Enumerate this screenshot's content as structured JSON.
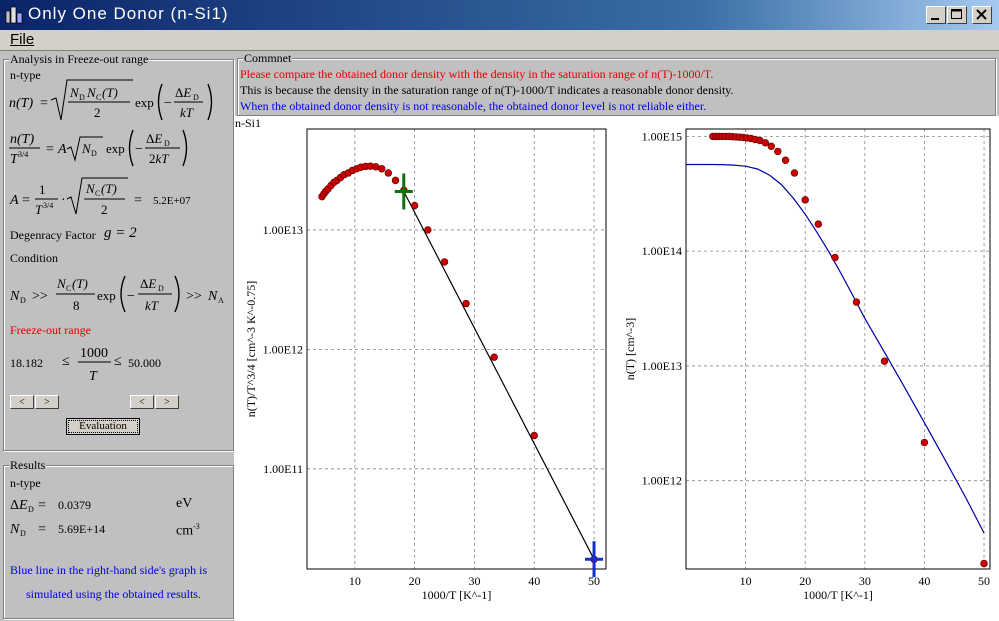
{
  "window": {
    "title": "Only One Donor (n-Si1)"
  },
  "menu": {
    "file": "File"
  },
  "analysis": {
    "group_title": "Analysis in Freeze-out range",
    "type_label": "n-type",
    "a_value": "5.2E+07",
    "degeneracy_label": "Degenracy Factor",
    "degeneracy_value": "g = 2",
    "condition_label": "Condition",
    "freezeout_label": "Freeze-out range",
    "range_min": "18.182",
    "range_max": "50.000",
    "le1": "≤",
    "le2": "≤",
    "btn_left": "<",
    "btn_right": ">",
    "evaluation_label": "Evaluation"
  },
  "results": {
    "group_title": "Results",
    "type_label": "n-type",
    "delta_e_value": "0.0379",
    "delta_e_unit": "eV",
    "nd_value": "5.69E+14",
    "nd_unit": "cm",
    "nd_unit_exp": "-3",
    "note_line1": "Blue line in the right-hand side's graph is",
    "note_line2": "simulated using the obtained results."
  },
  "comment": {
    "group_title": "Commnet",
    "line1": "Please compare the obtained donor density with the density in the saturation range of n(T)-1000/T.",
    "line2": "This is because the density in the saturation range of n(T)-1000/T indicates a reasonable donor density.",
    "line3": "When the obtained donor density is not reasonable, the obtained donor level is not reliable either."
  },
  "sample_label": "n-Si1",
  "colors": {
    "red_text": "#e00000",
    "blue_text": "#0000e0",
    "marker": "#cc0000",
    "fit_line": "#000000",
    "sim_line": "#0000aa",
    "cursor_green": "#107010",
    "cursor_blue": "#1030d0"
  },
  "chart_data": [
    {
      "type": "scatter",
      "scale_y": "log",
      "xlabel": "1000/T  [K^-1]",
      "ylabel": "n(T)/T^3/4  [cm^-3 K^-0.75]",
      "xlim": [
        2,
        52
      ],
      "ylim": [
        14500000000.0,
        70000000000000.0
      ],
      "x_ticks": [
        10,
        20,
        30,
        40,
        50
      ],
      "y_ticks": [
        {
          "v": 10000000000000.0,
          "label": "1.00E13"
        },
        {
          "v": 1000000000000.0,
          "label": "1.00E12"
        },
        {
          "v": 100000000000.0,
          "label": "1.00E11"
        }
      ],
      "grid": true,
      "points": [
        [
          4.5,
          19000000000000.0
        ],
        [
          4.8,
          20000000000000.0
        ],
        [
          5.1,
          21000000000000.0
        ],
        [
          5.5,
          22000000000000.0
        ],
        [
          6.0,
          23500000000000.0
        ],
        [
          6.5,
          25000000000000.0
        ],
        [
          7.0,
          26000000000000.0
        ],
        [
          7.6,
          27500000000000.0
        ],
        [
          8.2,
          29000000000000.0
        ],
        [
          8.9,
          30000000000000.0
        ],
        [
          9.6,
          31500000000000.0
        ],
        [
          10.3,
          32500000000000.0
        ],
        [
          11.0,
          33500000000000.0
        ],
        [
          11.8,
          34000000000000.0
        ],
        [
          12.6,
          34200000000000.0
        ],
        [
          13.5,
          33800000000000.0
        ],
        [
          14.5,
          32500000000000.0
        ],
        [
          15.6,
          30000000000000.0
        ],
        [
          16.8,
          26000000000000.0
        ],
        [
          18.2,
          21500000000000.0
        ],
        [
          20.0,
          16000000000000.0
        ],
        [
          22.2,
          10000000000000.0
        ],
        [
          25.0,
          5400000000000.0
        ],
        [
          28.6,
          2420000000000.0
        ],
        [
          33.3,
          860000000000.0
        ],
        [
          40.0,
          190000000000.0
        ],
        [
          50.0,
          17500000000.0
        ]
      ],
      "fit_line": [
        [
          18.182,
          21000000000000.0
        ],
        [
          50.0,
          17500000000.0
        ]
      ],
      "cursors": [
        {
          "x": 18.182,
          "y": 21000000000000.0,
          "color": "green"
        },
        {
          "x": 50.0,
          "y": 17500000000.0,
          "color": "blue"
        }
      ]
    },
    {
      "type": "scatter",
      "scale_y": "log",
      "xlabel": "1000/T  [K^-1]",
      "ylabel": "n(T)  [cm^-3]",
      "xlim": [
        0,
        51
      ],
      "ylim": [
        170000000000.0,
        1160000000000000.0
      ],
      "x_ticks": [
        10,
        20,
        30,
        40,
        50
      ],
      "y_ticks": [
        {
          "v": 1000000000000000.0,
          "label": "1.00E15"
        },
        {
          "v": 100000000000000.0,
          "label": "1.00E14"
        },
        {
          "v": 10000000000000.0,
          "label": "1.00E13"
        },
        {
          "v": 1000000000000.0,
          "label": "1.00E12"
        }
      ],
      "grid": true,
      "points": [
        [
          4.5,
          1000000000000000.0
        ],
        [
          5.0,
          1000000000000000.0
        ],
        [
          5.5,
          1000000000000000.0
        ],
        [
          6.0,
          1000000000000000.0
        ],
        [
          6.6,
          1000000000000000.0
        ],
        [
          7.2,
          1000000000000000.0
        ],
        [
          7.8,
          995000000000000.0
        ],
        [
          8.4,
          990000000000000.0
        ],
        [
          9.0,
          985000000000000.0
        ],
        [
          9.6,
          980000000000000.0
        ],
        [
          10.2,
          970000000000000.0
        ],
        [
          10.9,
          960000000000000.0
        ],
        [
          11.6,
          940000000000000.0
        ],
        [
          12.4,
          920000000000000.0
        ],
        [
          13.3,
          880000000000000.0
        ],
        [
          14.3,
          820000000000000.0
        ],
        [
          15.4,
          740000000000000.0
        ],
        [
          16.7,
          620000000000000.0
        ],
        [
          18.2,
          480000000000000.0
        ],
        [
          20.0,
          280000000000000.0
        ],
        [
          22.2,
          172000000000000.0
        ],
        [
          25.0,
          88000000000000.0
        ],
        [
          28.6,
          36000000000000.0
        ],
        [
          33.3,
          11000000000000.0
        ],
        [
          40.0,
          2150000000000.0
        ],
        [
          50.0,
          190000000000.0
        ]
      ],
      "sim_line": [
        [
          0,
          569000000000000.0
        ],
        [
          4,
          569000000000000.0
        ],
        [
          6,
          568000000000000.0
        ],
        [
          8,
          562000000000000.0
        ],
        [
          10,
          550000000000000.0
        ],
        [
          12,
          520000000000000.0
        ],
        [
          14,
          460000000000000.0
        ],
        [
          16,
          380000000000000.0
        ],
        [
          18,
          290000000000000.0
        ],
        [
          20,
          210000000000000.0
        ],
        [
          22,
          145000000000000.0
        ],
        [
          24,
          98000000000000.0
        ],
        [
          26,
          64000000000000.0
        ],
        [
          28,
          41000000000000.0
        ],
        [
          30,
          26000000000000.0
        ],
        [
          33,
          14000000000000.0
        ],
        [
          36,
          7500000000000.0
        ],
        [
          40,
          3200000000000.0
        ],
        [
          44,
          1350000000000.0
        ],
        [
          47,
          700000000000.0
        ],
        [
          50,
          350000000000.0
        ]
      ]
    }
  ]
}
